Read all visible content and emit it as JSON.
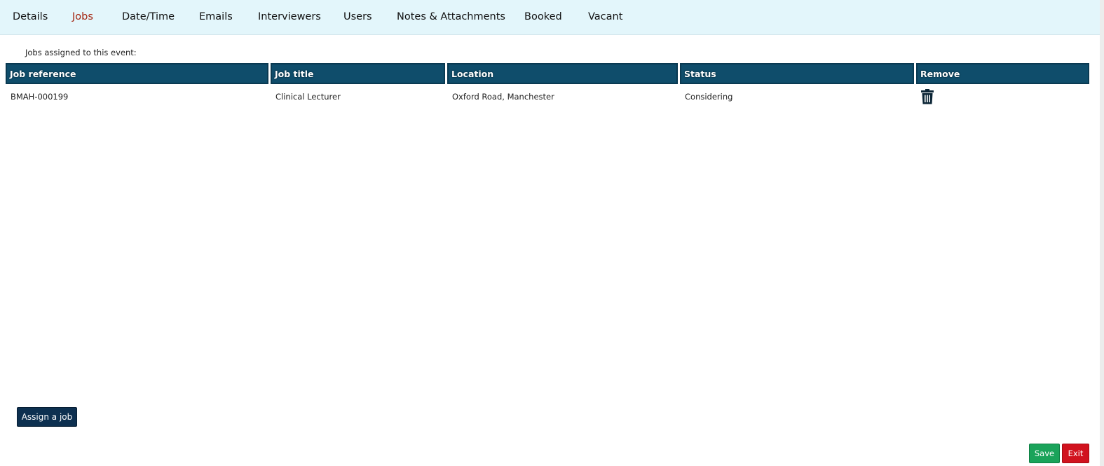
{
  "tabs": [
    {
      "label": "Details",
      "active": false
    },
    {
      "label": "Jobs",
      "active": true
    },
    {
      "label": "Date/Time",
      "active": false
    },
    {
      "label": "Emails",
      "active": false
    },
    {
      "label": "Interviewers",
      "active": false
    },
    {
      "label": "Users",
      "active": false
    },
    {
      "label": "Notes & Attachments",
      "active": false
    },
    {
      "label": "Booked",
      "active": false
    },
    {
      "label": "Vacant",
      "active": false
    }
  ],
  "main": {
    "caption": "Jobs assigned to this event:",
    "columns": [
      "Job reference",
      "Job title",
      "Location",
      "Status",
      "Remove"
    ],
    "rows": [
      {
        "job_reference": "BMAH-000199",
        "job_title": "Clinical Lecturer",
        "location": "Oxford Road, Manchester",
        "status": "Considering",
        "remove_icon": "trash-icon"
      }
    ]
  },
  "actions": {
    "assign_label": "Assign a job",
    "save_label": "Save",
    "exit_label": "Exit"
  },
  "colors": {
    "tabbar_bg": "#e3f6fb",
    "active_tab": "#a3240f",
    "table_header": "#0f4d6b",
    "assign_button": "#0d3050",
    "save_button": "#1aa35a",
    "exit_button": "#d1121e"
  }
}
